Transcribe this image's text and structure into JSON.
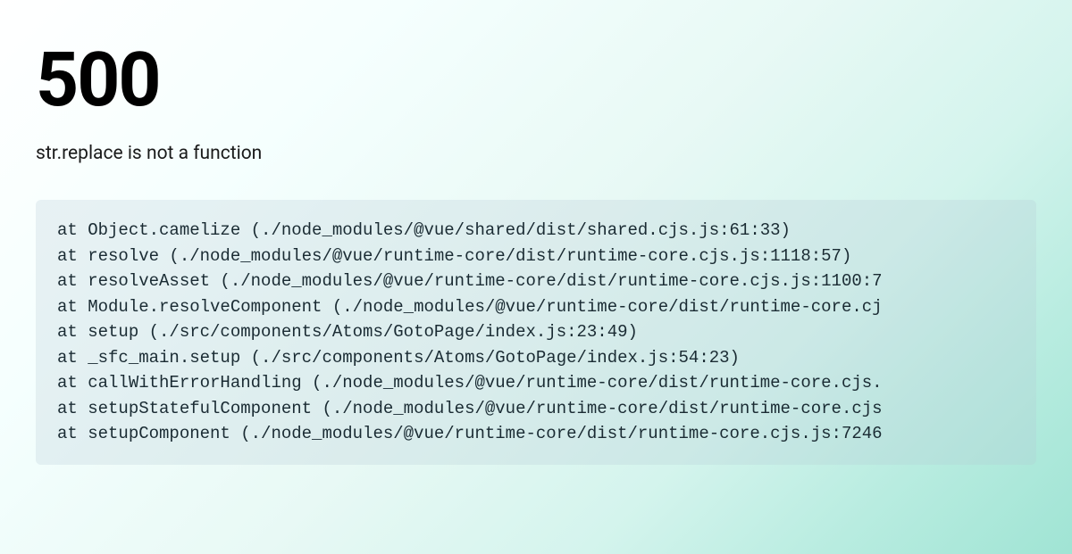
{
  "error": {
    "code": "500",
    "message": "str.replace is not a function",
    "stack": [
      "at Object.camelize (./node_modules/@vue/shared/dist/shared.cjs.js:61:33)",
      "at resolve (./node_modules/@vue/runtime-core/dist/runtime-core.cjs.js:1118:57)",
      "at resolveAsset (./node_modules/@vue/runtime-core/dist/runtime-core.cjs.js:1100:7",
      "at Module.resolveComponent (./node_modules/@vue/runtime-core/dist/runtime-core.cj",
      "at setup (./src/components/Atoms/GotoPage/index.js:23:49)",
      "at _sfc_main.setup (./src/components/Atoms/GotoPage/index.js:54:23)",
      "at callWithErrorHandling (./node_modules/@vue/runtime-core/dist/runtime-core.cjs.",
      "at setupStatefulComponent (./node_modules/@vue/runtime-core/dist/runtime-core.cjs",
      "at setupComponent (./node_modules/@vue/runtime-core/dist/runtime-core.cjs.js:7246"
    ]
  }
}
